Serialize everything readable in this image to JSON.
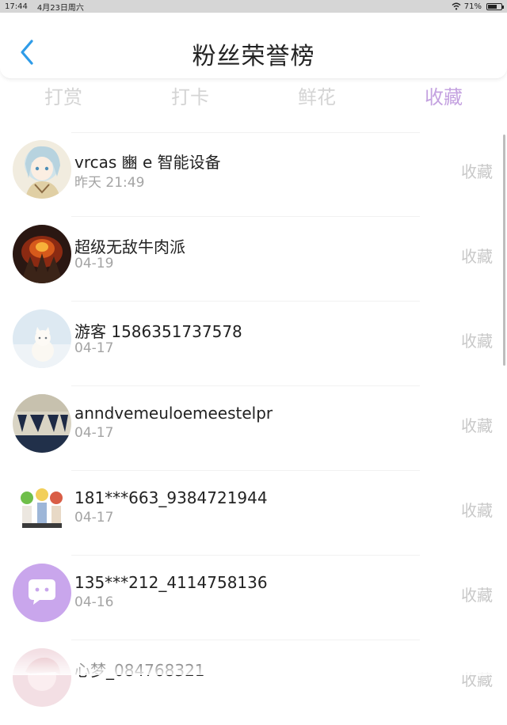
{
  "status": {
    "time": "17:44",
    "date": "4月23日周六",
    "battery": "71%",
    "battery_level": 0.71
  },
  "nav": {
    "title": "粉丝荣誉榜"
  },
  "tabs": [
    {
      "label": "打赏",
      "active": false
    },
    {
      "label": "打卡",
      "active": false
    },
    {
      "label": "鲜花",
      "active": false
    },
    {
      "label": "收藏",
      "active": true
    }
  ],
  "fans": [
    {
      "name": "vrcas 豳 e 智能设备",
      "date": "昨天 21:49",
      "action": "收藏",
      "avatar": "anime-girl-avatar"
    },
    {
      "name": "超级无敌牛肉派",
      "date": "04-19",
      "action": "收藏",
      "avatar": "fire-avatar"
    },
    {
      "name": "游客 1586351737578",
      "date": "04-17",
      "action": "收藏",
      "avatar": "cat-avatar"
    },
    {
      "name": "anndvemeuloemeestelpr",
      "date": "04-17",
      "action": "收藏",
      "avatar": "text-art-avatar"
    },
    {
      "name": "181***663_9384721944",
      "date": "04-17",
      "action": "收藏",
      "avatar": "anime-group-avatar"
    },
    {
      "name": "135***212_4114758136",
      "date": "04-16",
      "action": "收藏",
      "avatar": "chat-bubble-avatar"
    },
    {
      "name": "心梦_084768321",
      "date": "",
      "action": "收藏",
      "avatar": "pink-avatar"
    }
  ],
  "colors": {
    "accent": "#c4a2e0",
    "back": "#2f9ce8"
  }
}
